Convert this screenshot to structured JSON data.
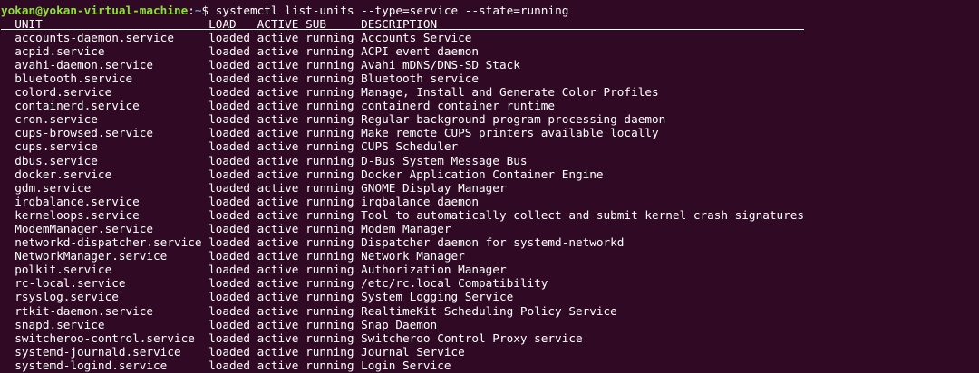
{
  "terminal": {
    "background": "#300a24",
    "foreground": "#ffffff",
    "prompt_color": "#8ae234",
    "path_color": "#729fcf"
  },
  "prompt": {
    "user_host": "yokan@yokan-virtual-machine",
    "separator": ":",
    "path": "~",
    "symbol": "$",
    "command": "systemctl list-units --type=service --state=running"
  },
  "table": {
    "columns": {
      "unit": "UNIT",
      "load": "LOAD",
      "active": "ACTIVE",
      "sub": "SUB",
      "description": "DESCRIPTION"
    },
    "rows": [
      {
        "unit": "accounts-daemon.service",
        "load": "loaded",
        "active": "active",
        "sub": "running",
        "description": "Accounts Service"
      },
      {
        "unit": "acpid.service",
        "load": "loaded",
        "active": "active",
        "sub": "running",
        "description": "ACPI event daemon"
      },
      {
        "unit": "avahi-daemon.service",
        "load": "loaded",
        "active": "active",
        "sub": "running",
        "description": "Avahi mDNS/DNS-SD Stack"
      },
      {
        "unit": "bluetooth.service",
        "load": "loaded",
        "active": "active",
        "sub": "running",
        "description": "Bluetooth service"
      },
      {
        "unit": "colord.service",
        "load": "loaded",
        "active": "active",
        "sub": "running",
        "description": "Manage, Install and Generate Color Profiles"
      },
      {
        "unit": "containerd.service",
        "load": "loaded",
        "active": "active",
        "sub": "running",
        "description": "containerd container runtime"
      },
      {
        "unit": "cron.service",
        "load": "loaded",
        "active": "active",
        "sub": "running",
        "description": "Regular background program processing daemon"
      },
      {
        "unit": "cups-browsed.service",
        "load": "loaded",
        "active": "active",
        "sub": "running",
        "description": "Make remote CUPS printers available locally"
      },
      {
        "unit": "cups.service",
        "load": "loaded",
        "active": "active",
        "sub": "running",
        "description": "CUPS Scheduler"
      },
      {
        "unit": "dbus.service",
        "load": "loaded",
        "active": "active",
        "sub": "running",
        "description": "D-Bus System Message Bus"
      },
      {
        "unit": "docker.service",
        "load": "loaded",
        "active": "active",
        "sub": "running",
        "description": "Docker Application Container Engine"
      },
      {
        "unit": "gdm.service",
        "load": "loaded",
        "active": "active",
        "sub": "running",
        "description": "GNOME Display Manager"
      },
      {
        "unit": "irqbalance.service",
        "load": "loaded",
        "active": "active",
        "sub": "running",
        "description": "irqbalance daemon"
      },
      {
        "unit": "kerneloops.service",
        "load": "loaded",
        "active": "active",
        "sub": "running",
        "description": "Tool to automatically collect and submit kernel crash signatures"
      },
      {
        "unit": "ModemManager.service",
        "load": "loaded",
        "active": "active",
        "sub": "running",
        "description": "Modem Manager"
      },
      {
        "unit": "networkd-dispatcher.service",
        "load": "loaded",
        "active": "active",
        "sub": "running",
        "description": "Dispatcher daemon for systemd-networkd"
      },
      {
        "unit": "NetworkManager.service",
        "load": "loaded",
        "active": "active",
        "sub": "running",
        "description": "Network Manager"
      },
      {
        "unit": "polkit.service",
        "load": "loaded",
        "active": "active",
        "sub": "running",
        "description": "Authorization Manager"
      },
      {
        "unit": "rc-local.service",
        "load": "loaded",
        "active": "active",
        "sub": "running",
        "description": "/etc/rc.local Compatibility"
      },
      {
        "unit": "rsyslog.service",
        "load": "loaded",
        "active": "active",
        "sub": "running",
        "description": "System Logging Service"
      },
      {
        "unit": "rtkit-daemon.service",
        "load": "loaded",
        "active": "active",
        "sub": "running",
        "description": "RealtimeKit Scheduling Policy Service"
      },
      {
        "unit": "snapd.service",
        "load": "loaded",
        "active": "active",
        "sub": "running",
        "description": "Snap Daemon"
      },
      {
        "unit": "switcheroo-control.service",
        "load": "loaded",
        "active": "active",
        "sub": "running",
        "description": "Switcheroo Control Proxy service"
      },
      {
        "unit": "systemd-journald.service",
        "load": "loaded",
        "active": "active",
        "sub": "running",
        "description": "Journal Service"
      },
      {
        "unit": "systemd-logind.service",
        "load": "loaded",
        "active": "active",
        "sub": "running",
        "description": "Login Service"
      }
    ]
  }
}
